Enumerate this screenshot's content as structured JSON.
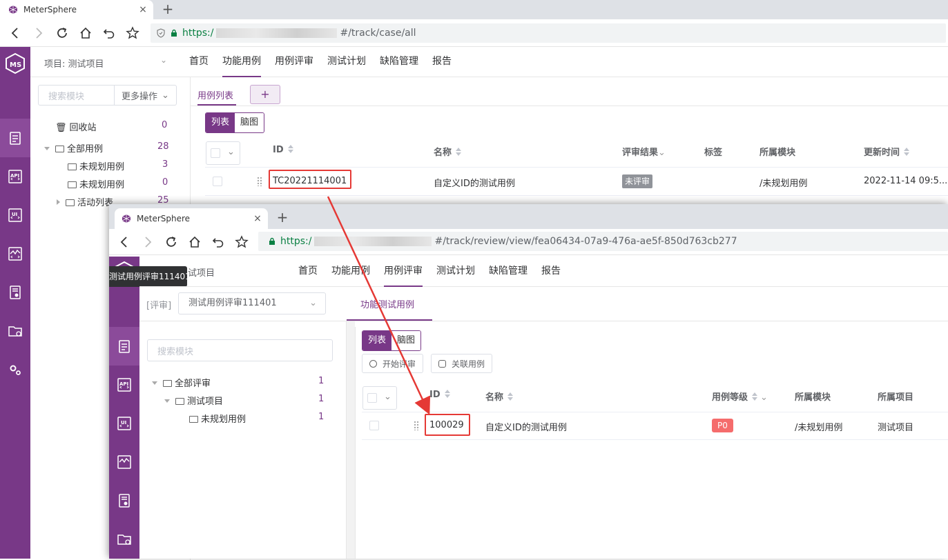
{
  "back": {
    "tab": {
      "title": "MeterSphere",
      "close": "×",
      "new_tab": "+"
    },
    "url": {
      "scheme": "https:/",
      "path": "#/track/case/all"
    },
    "header": {
      "project": "项目: 测试项目",
      "menus": [
        "首页",
        "功能用例",
        "用例评审",
        "测试计划",
        "缺陷管理",
        "报告"
      ],
      "active_menu": "功能用例"
    },
    "sidebar": {
      "search_placeholder": "搜索模块",
      "more_ops": "更多操作",
      "tree": [
        {
          "label": "回收站",
          "count": "0"
        },
        {
          "label": "全部用例",
          "count": "28"
        },
        {
          "label": "未规划用例",
          "count": "3"
        },
        {
          "label": "未规划用例",
          "count": "0"
        },
        {
          "label": "活动列表",
          "count": "25"
        }
      ]
    },
    "main": {
      "subtab": "用例列表",
      "add": "+",
      "view_list": "列表",
      "view_mind": "脑图",
      "columns": [
        "ID",
        "名称",
        "评审结果",
        "标签",
        "所属模块",
        "更新时间"
      ],
      "rows": [
        {
          "id": "TC20221114001",
          "name": "自定义ID的测试用例",
          "review": "未评审",
          "tag": "",
          "module": "/未规划用例",
          "updated": "2022-11-14 09:5..."
        }
      ]
    }
  },
  "front": {
    "tab": {
      "title": "MeterSphere",
      "close": "×",
      "new_tab": "+"
    },
    "url": {
      "scheme": "https:/",
      "path": "#/track/review/view/fea06434-07a9-476a-ae5f-850d763cb277"
    },
    "tooltip": "测试用例评审111401",
    "header": {
      "project": "试项目",
      "menus": [
        "首页",
        "功能用例",
        "用例评审",
        "测试计划",
        "缺陷管理",
        "报告"
      ],
      "active_menu": "用例评审"
    },
    "review_prefix": "[评审]",
    "review_select": "测试用例评审111401",
    "subtab": "功能测试用例",
    "sidebar": {
      "search_placeholder": "搜索模块",
      "tree": [
        {
          "label": "全部评审",
          "count": "1"
        },
        {
          "label": "测试项目",
          "count": "1"
        },
        {
          "label": "未规划用例",
          "count": "1"
        }
      ]
    },
    "main": {
      "view_list": "列表",
      "view_mind": "脑图",
      "btn_start": "开始评审",
      "btn_link": "关联用例",
      "columns": [
        "ID",
        "名称",
        "用例等级",
        "所属模块",
        "所属项目"
      ],
      "rows": [
        {
          "id": "100029",
          "name": "自定义ID的测试用例",
          "level": "P0",
          "module": "/未规划用例",
          "project": "测试项目"
        }
      ]
    }
  },
  "colors": {
    "brand": "#783887",
    "annotation": "#e53935",
    "badge_gray": "#909399",
    "badge_red": "#f56c6c"
  }
}
